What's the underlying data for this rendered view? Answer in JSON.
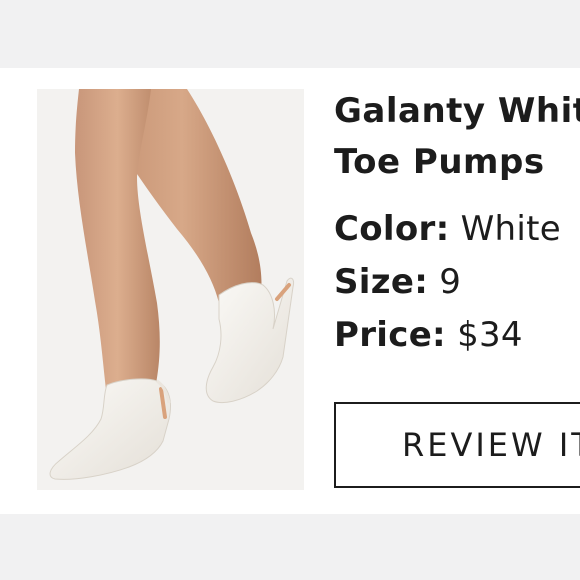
{
  "product": {
    "title_line1": "Galanty White",
    "title_line2": "Toe Pumps",
    "image_alt": "white satin pointed toe pumps",
    "attributes": [
      {
        "key": "Color:",
        "value": "White"
      },
      {
        "key": "Size:",
        "value": "9"
      },
      {
        "key": "Price:",
        "value": "$34"
      }
    ]
  },
  "actions": {
    "review_label": "REVIEW ITEM"
  },
  "colors": {
    "background": "#f1f1f2",
    "card": "#ffffff",
    "text": "#1c1c1c",
    "skin": "#d4a683",
    "shoe": "#f4f1ec"
  }
}
